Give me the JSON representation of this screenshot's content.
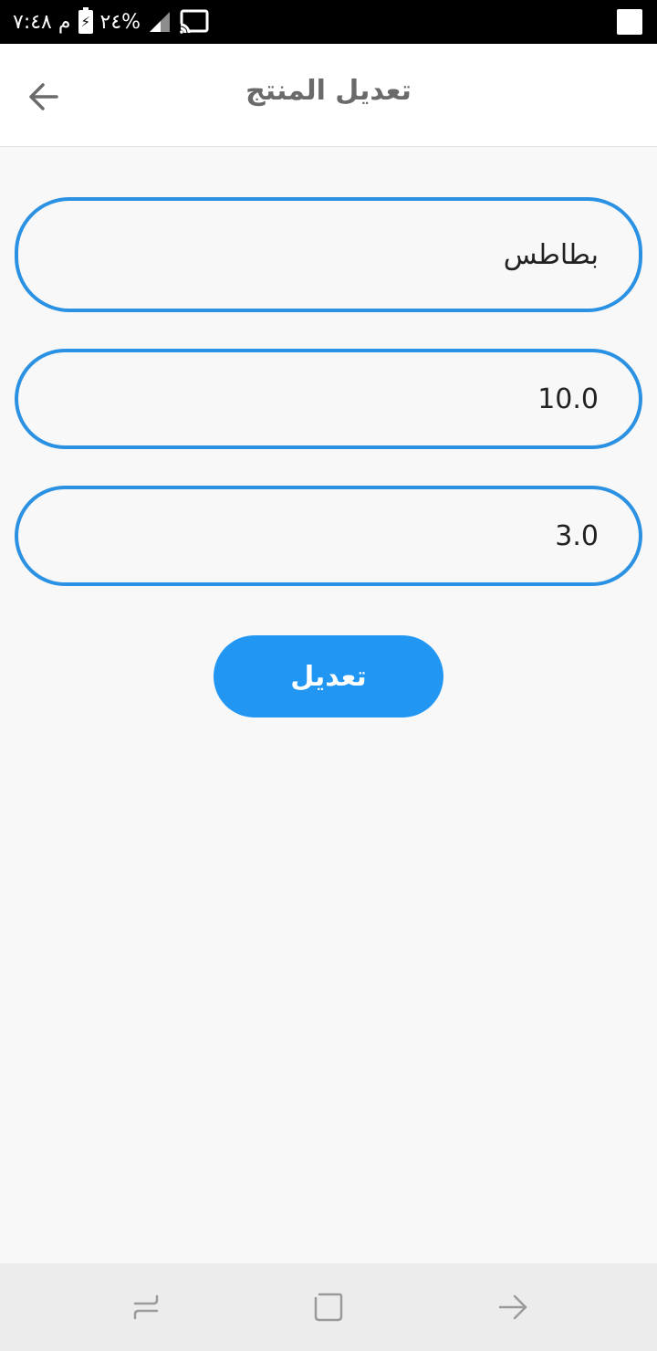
{
  "status_bar": {
    "time": "م ٧:٤٨",
    "battery": "٢٤%",
    "icons": [
      "battery-icon",
      "signal-icon",
      "cast-icon"
    ]
  },
  "app_bar": {
    "title": "تعديل المنتج",
    "back_icon": "arrow-left-icon"
  },
  "form": {
    "name_value": "بطاطس",
    "price_value": "10.0",
    "quantity_value": "3.0"
  },
  "submit": {
    "label": "تعديل"
  },
  "nav_bar": {
    "icons": [
      "recent-apps-icon",
      "home-icon",
      "back-icon"
    ]
  },
  "colors": {
    "accent": "#2196f3",
    "field_border": "#2b91e3",
    "title": "#6a6a6a"
  }
}
